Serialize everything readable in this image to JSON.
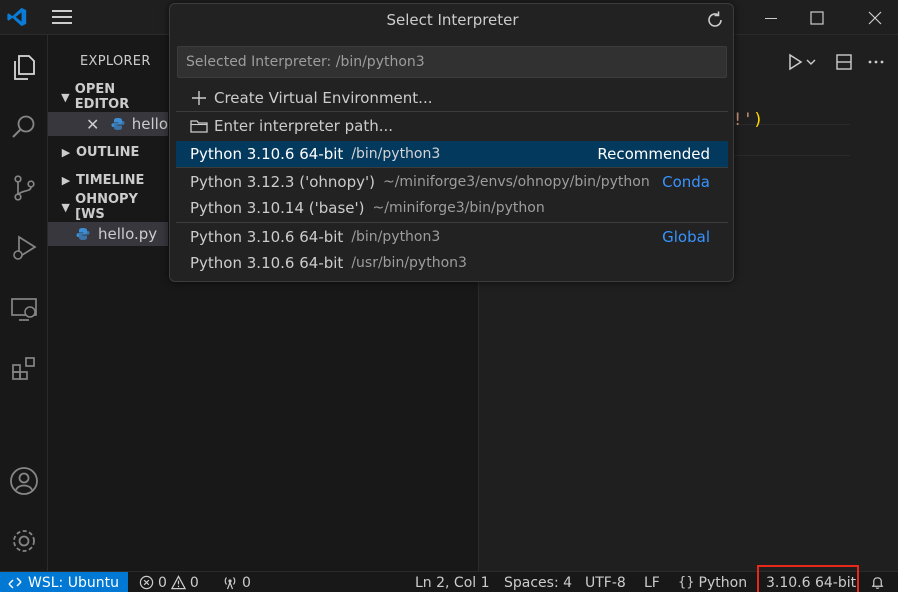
{
  "titlebar": {
    "logo_icon": "vscode-logo-icon",
    "menu_icon": "menu-icon",
    "restore_icon": "restore-icon",
    "maximize_icon": "maximize-icon",
    "close_icon": "close-icon"
  },
  "activitybar": {
    "items": [
      "explorer-icon",
      "search-icon",
      "source-control-icon",
      "run-debug-icon",
      "remote-explorer-icon",
      "extensions-icon",
      "accounts-icon",
      "settings-gear-icon"
    ]
  },
  "sidebar": {
    "title": "EXPLORER",
    "sections": {
      "open_editors": "OPEN EDITOR",
      "outline": "OUTLINE",
      "timeline": "TIMELINE",
      "workspace": "OHNOPY [WS"
    },
    "open_editor_file": "hello",
    "workspace_file": "hello.py"
  },
  "editor": {
    "code_fragment": "ld!'",
    "code_paren": ")"
  },
  "quick_pick": {
    "title": "Select Interpreter",
    "input_placeholder": "Selected Interpreter: /bin/python3",
    "actions": [
      {
        "label": "Create Virtual Environment...",
        "icon": "plus-icon"
      },
      {
        "label": "Enter interpreter path...",
        "icon": "folder-icon"
      }
    ],
    "items": [
      {
        "label": "Python 3.10.6 64-bit",
        "path": "/bin/python3",
        "tag": "Recommended"
      },
      {
        "label": "Python 3.12.3 ('ohnopy')",
        "path": "~/miniforge3/envs/ohnopy/bin/python",
        "tag": "Conda"
      },
      {
        "label": "Python 3.10.14 ('base')",
        "path": "~/miniforge3/bin/python",
        "tag": ""
      },
      {
        "label": "Python 3.10.6 64-bit",
        "path": "/bin/python3",
        "tag": "Global"
      },
      {
        "label": "Python 3.10.6 64-bit",
        "path": "/usr/bin/python3",
        "tag": ""
      }
    ]
  },
  "statusbar": {
    "remote": "WSL: Ubuntu",
    "errors": "0",
    "warnings": "0",
    "ports": "0",
    "position": "Ln 2, Col 1",
    "spaces": "Spaces: 4",
    "encoding": "UTF-8",
    "eol": "LF",
    "language": "Python",
    "interpreter": "3.10.6 64-bit"
  },
  "colors": {
    "accent": "#0078d4",
    "selection": "#04395e",
    "highlight_box": "#e8281b",
    "link": "#3794ff"
  }
}
